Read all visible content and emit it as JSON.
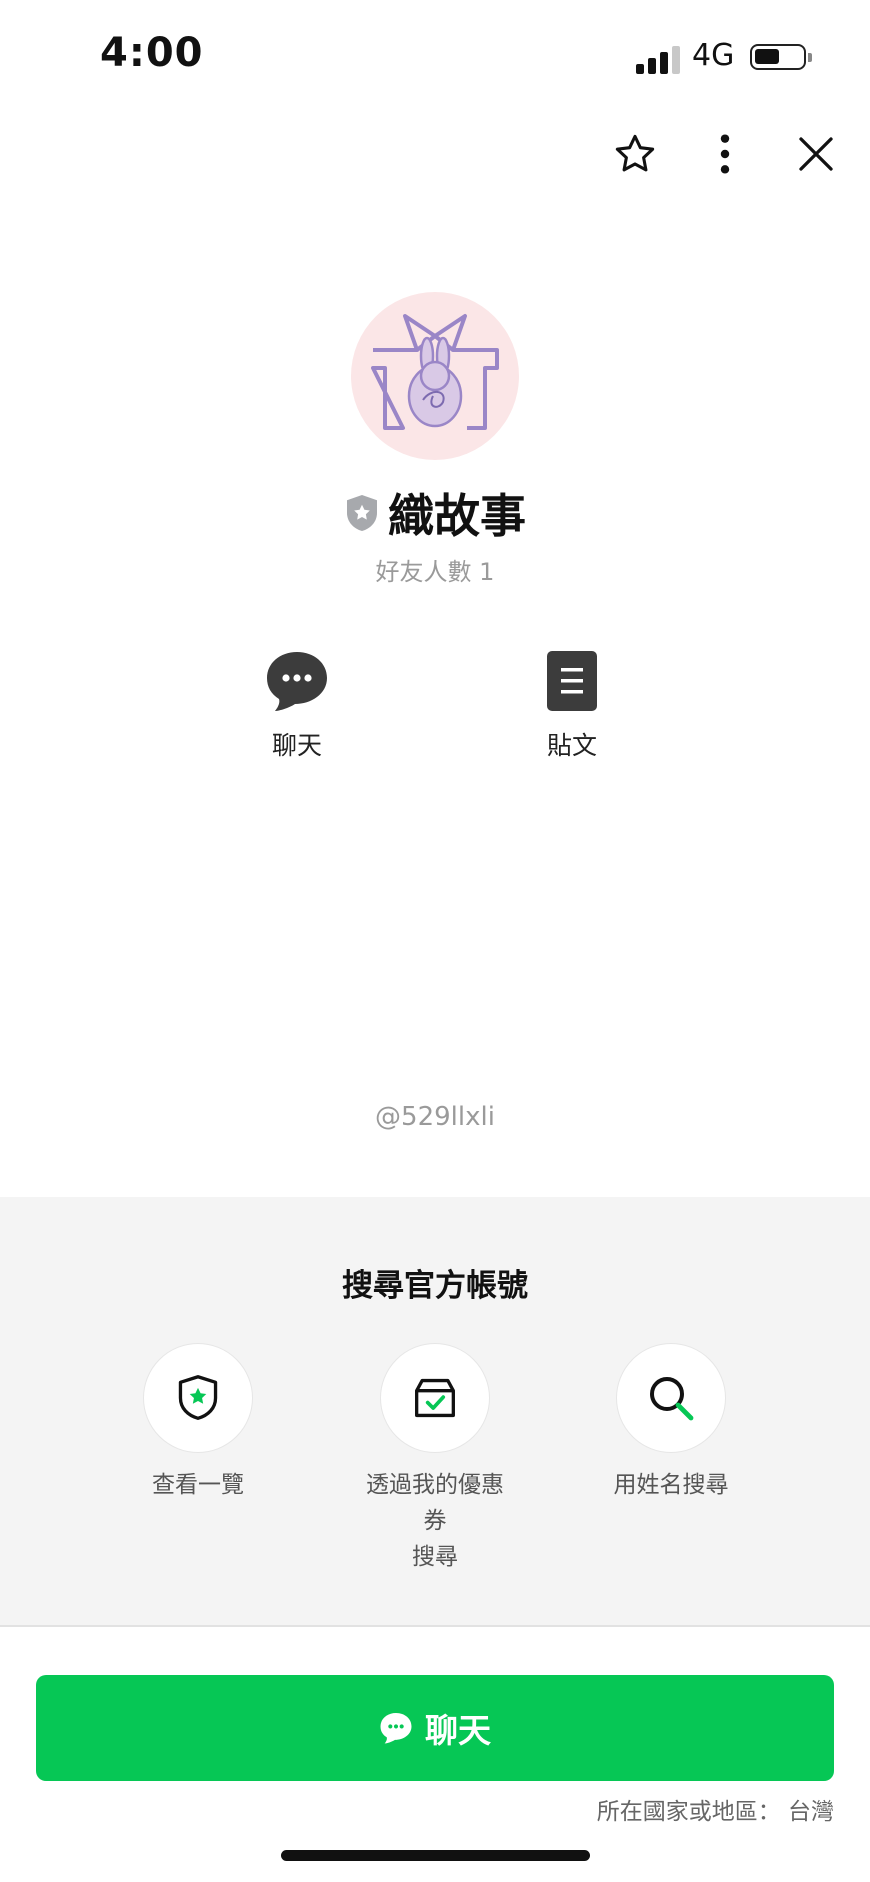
{
  "status_bar": {
    "time": "4:00",
    "network": "4G",
    "battery_level": 0.5
  },
  "header": {
    "icons": [
      "star-icon",
      "more-vertical-icon",
      "close-icon"
    ]
  },
  "profile": {
    "name": "織故事",
    "friends": "好友人數 1",
    "badge_color": "#a7a9ad",
    "avatar_bg": "#fbe6e7",
    "avatar_line": "#9a86c7",
    "actions": [
      {
        "label": "聊天",
        "icon": "chat-bubble-icon"
      },
      {
        "label": "貼文",
        "icon": "post-document-icon"
      }
    ],
    "handle": "@529llxli"
  },
  "search_section": {
    "title": "搜尋官方帳號",
    "options": [
      {
        "label": "查看一覽",
        "icon": "shield-star-icon"
      },
      {
        "label_lines": [
          "透過我的優惠",
          "券",
          "搜尋"
        ],
        "icon": "coupon-box-icon"
      },
      {
        "label": "用姓名搜尋",
        "icon": "search-icon"
      }
    ]
  },
  "chat_button": {
    "label": "聊天",
    "icon": "chat-bubble-icon",
    "color": "#06c755"
  },
  "region": {
    "text": "所在國家或地區： 台灣"
  }
}
